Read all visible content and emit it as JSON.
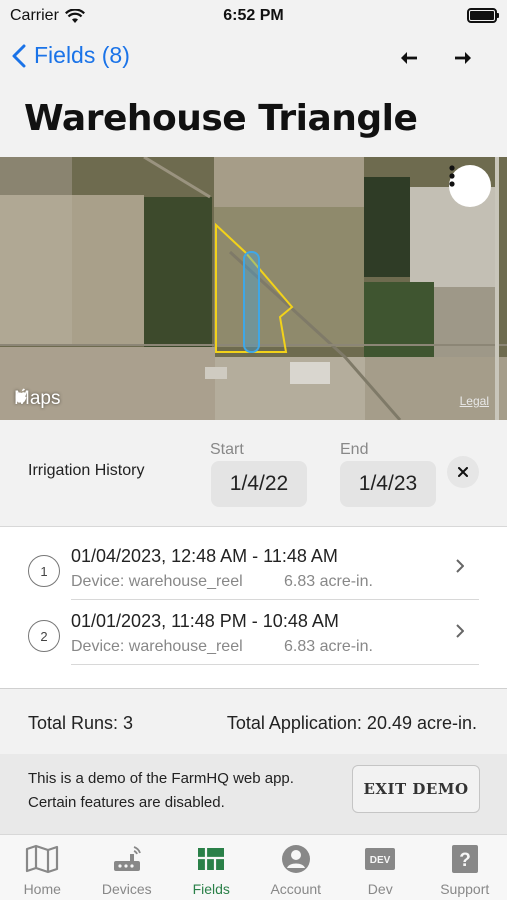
{
  "status_bar": {
    "carrier": "Carrier",
    "time": "6:52 PM"
  },
  "header": {
    "back_label": "Fields (8)",
    "prev_icon": "arrow-left-icon",
    "next_icon": "arrow-right-icon"
  },
  "page": {
    "title": "Warehouse Triangle"
  },
  "map": {
    "provider": "Maps",
    "legal": "Legal",
    "menu_icon": "more-vertical-icon"
  },
  "history": {
    "label": "Irrigation History",
    "start_label": "Start",
    "start_value": "1/4/22",
    "end_label": "End",
    "end_value": "1/4/23",
    "clear_icon": "close-icon"
  },
  "runs": [
    {
      "number": "1",
      "time_range": "01/04/2023, 12:48 AM - 11:48 AM",
      "device": "Device: warehouse_reel",
      "amount": "6.83 acre-in."
    },
    {
      "number": "2",
      "time_range": "01/01/2023, 11:48 PM - 10:48 AM",
      "device": "Device: warehouse_reel",
      "amount": "6.83 acre-in."
    }
  ],
  "totals": {
    "runs": "Total Runs: 3",
    "application": "Total Application: 20.49 acre-in."
  },
  "demo": {
    "message": "This is a demo of the FarmHQ web app. Certain features are disabled.",
    "exit_label": "EXIT DEMO"
  },
  "tabs": [
    {
      "label": "Home",
      "icon": "map-icon",
      "active": false
    },
    {
      "label": "Devices",
      "icon": "device-icon",
      "active": false
    },
    {
      "label": "Fields",
      "icon": "fields-grid-icon",
      "active": true
    },
    {
      "label": "Account",
      "icon": "account-icon",
      "active": false
    },
    {
      "label": "Dev",
      "icon": "dev-icon",
      "active": false
    },
    {
      "label": "Support",
      "icon": "help-icon",
      "active": false
    }
  ],
  "colors": {
    "accent_blue": "#1a73e8",
    "active_tab_green": "#2a8048",
    "field_outline": "#f2d21a",
    "run_overlay": "#3fa7e6"
  }
}
